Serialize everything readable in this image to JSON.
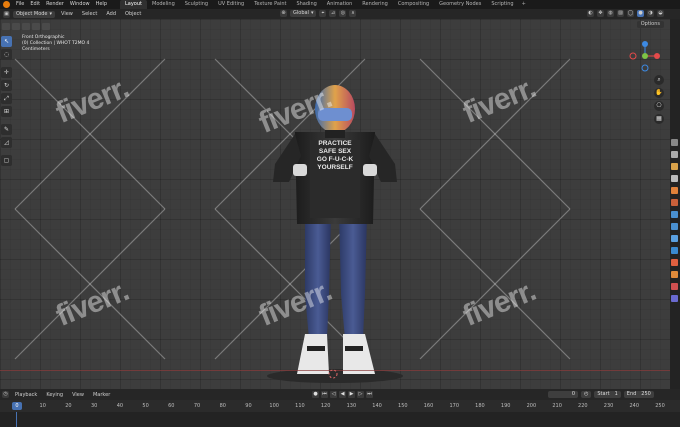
{
  "menu": [
    "File",
    "Edit",
    "Render",
    "Window",
    "Help"
  ],
  "workspace_tabs": [
    {
      "label": "Layout",
      "active": true
    },
    {
      "label": "Modeling"
    },
    {
      "label": "Sculpting"
    },
    {
      "label": "UV Editing"
    },
    {
      "label": "Texture Paint"
    },
    {
      "label": "Shading"
    },
    {
      "label": "Animation"
    },
    {
      "label": "Rendering"
    },
    {
      "label": "Compositing"
    },
    {
      "label": "Geometry Nodes"
    },
    {
      "label": "Scripting"
    }
  ],
  "tab_add": "+",
  "header": {
    "mode": "Object Mode",
    "menus": [
      "View",
      "Select",
      "Add",
      "Object"
    ],
    "transform_orientation": "Global"
  },
  "viewport": {
    "info_lines": [
      "Front Orthographic",
      "(0) Collection | WHOT T2MO 4",
      "Centimeters"
    ],
    "options_label": "Options",
    "watermark_text": "fiverr."
  },
  "model": {
    "shirt_text": [
      "PRACTICE",
      "SAFE SEX",
      "GO F-U-C-K",
      "YOURSELF"
    ]
  },
  "gizmo": {
    "x_color": "#e54a4a",
    "y_color": "#7dc346",
    "z_color": "#3d8ae3"
  },
  "timeline": {
    "menus": [
      "Playback",
      "Keying",
      "View",
      "Marker"
    ],
    "current_frame": "0",
    "start_label": "Start",
    "start_value": "1",
    "end_label": "End",
    "end_value": "250",
    "frame_field": "0",
    "ticks": [
      "0",
      "10",
      "20",
      "30",
      "40",
      "50",
      "60",
      "70",
      "80",
      "90",
      "100",
      "110",
      "120",
      "130",
      "140",
      "150",
      "160",
      "170",
      "180",
      "190",
      "200",
      "210",
      "220",
      "230",
      "240",
      "250"
    ]
  },
  "colors": {
    "accent": "#4772b3",
    "blender_orange": "#e87d0d"
  }
}
